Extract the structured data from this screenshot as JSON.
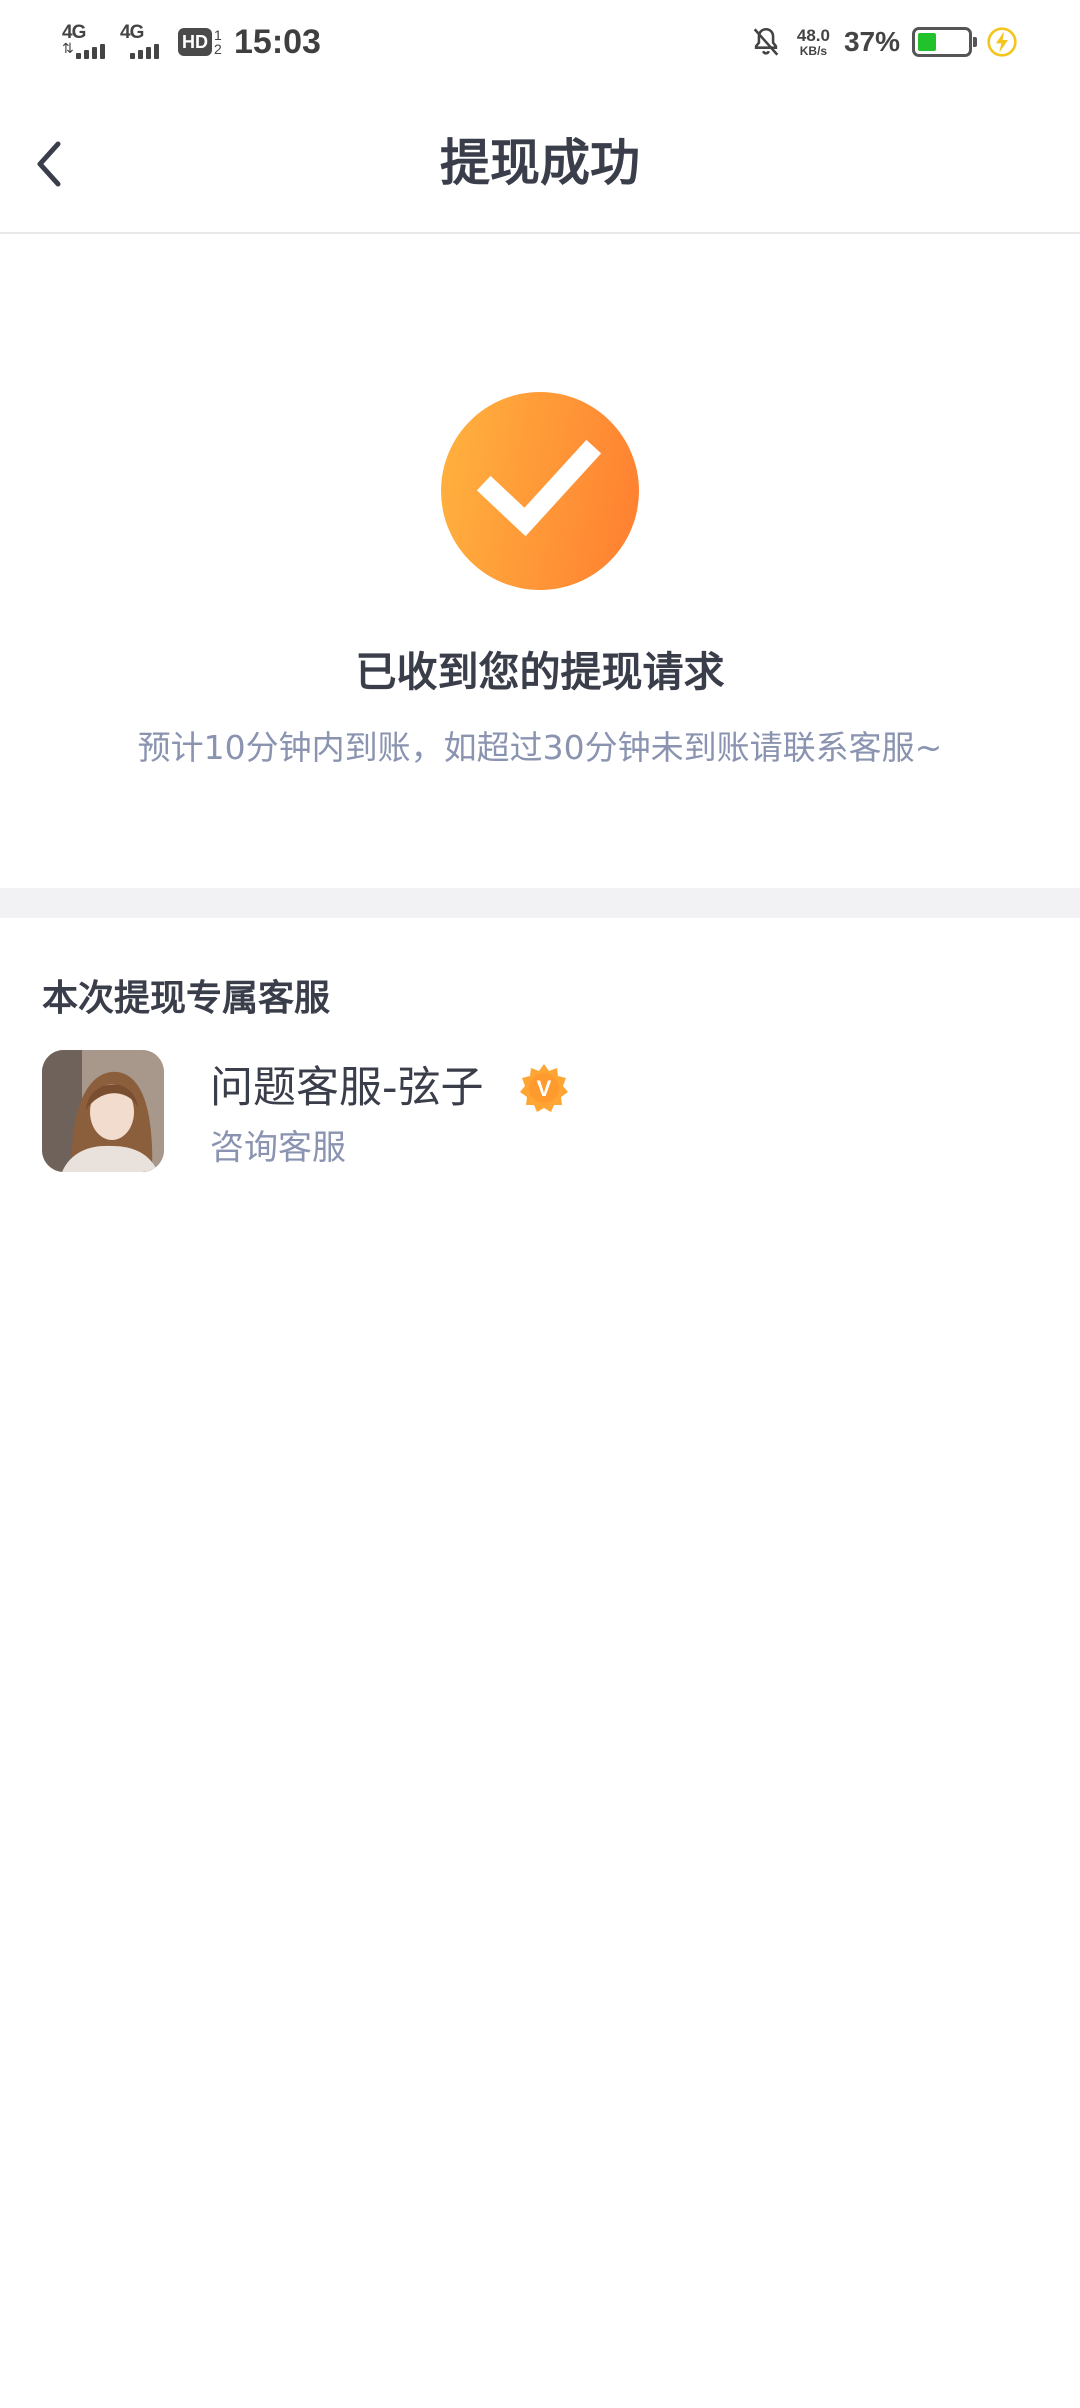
{
  "status_bar": {
    "network1": "4G",
    "network2": "4G",
    "hd_label": "HD",
    "hd_sim": "1 2",
    "time": "15:03",
    "speed_value": "48.0",
    "speed_unit": "KB/s",
    "battery_percent": "37%",
    "battery_level": 0.37,
    "battery_color": "#22c22c"
  },
  "nav": {
    "back_icon": "chevron-left-icon",
    "title": "提现成功"
  },
  "success": {
    "icon": "check-circle-icon",
    "accent_start": "#ffb33f",
    "accent_end": "#ff7e30",
    "title": "已收到您的提现请求",
    "description": "预计10分钟内到账，如超过30分钟未到账请联系客服~"
  },
  "service": {
    "heading": "本次提现专属客服",
    "agent": {
      "name": "问题客服-弦子",
      "badge": "V",
      "role": "咨询客服"
    }
  }
}
